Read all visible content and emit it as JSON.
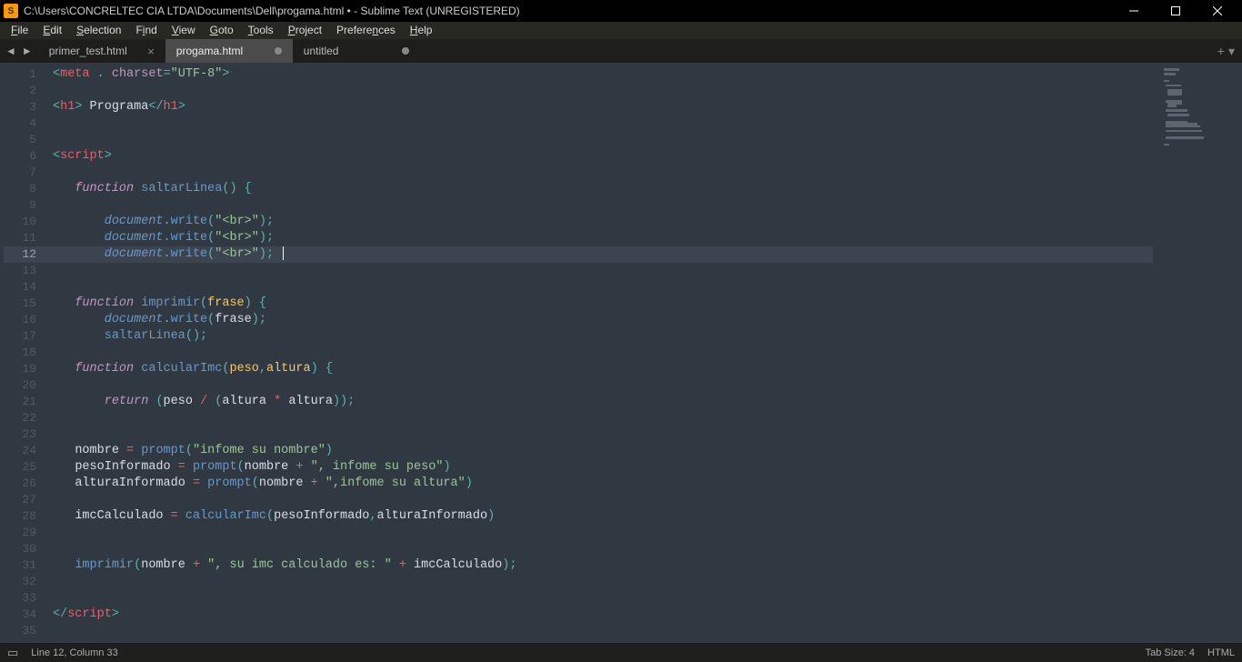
{
  "window": {
    "title": "C:\\Users\\CONCRELTEC CIA LTDA\\Documents\\Dell\\progama.html • - Sublime Text (UNREGISTERED)"
  },
  "menu": {
    "file": "File",
    "edit": "Edit",
    "selection": "Selection",
    "find": "Find",
    "view": "View",
    "goto": "Goto",
    "tools": "Tools",
    "project": "Project",
    "preferences": "Preferences",
    "help": "Help"
  },
  "tabs": {
    "t0": {
      "label": "primer_test.html"
    },
    "t1": {
      "label": "progama.html"
    },
    "t2": {
      "label": "untitled"
    }
  },
  "gutter": {
    "line_start": 1,
    "line_end": 35,
    "active_line": 12
  },
  "status": {
    "pos": "Line 12, Column 33",
    "tab_size": "Tab Size: 4",
    "syntax": "HTML"
  },
  "code": {
    "raw": "<meta . charset=\"UTF-8\">\n\n<h1> Programa</h1>\n\n\n<script>\n\n   function saltarLinea() {\n\n       document.write(\"<br>\");\n       document.write(\"<br>\");\n       document.write(\"<br>\"); \n\n\n   function imprimir(frase) {\n       document.write(frase);\n       saltarLinea();\n\n   function calcularImc(peso,altura) {\n\n       return (peso / (altura * altura));\n\n\n   nombre = prompt(\"infome su nombre\")\n   pesoInformado = prompt(nombre + \", infome su peso\")\n   alturaInformado = prompt(nombre + \",infome su altura\")\n\n   imcCalculado = calcularImc(pesoInformado,alturaInformado)\n\n\n   imprimir(nombre + \", su imc calculado es: \" + imcCalculado);\n\n\n</script>\n"
  }
}
